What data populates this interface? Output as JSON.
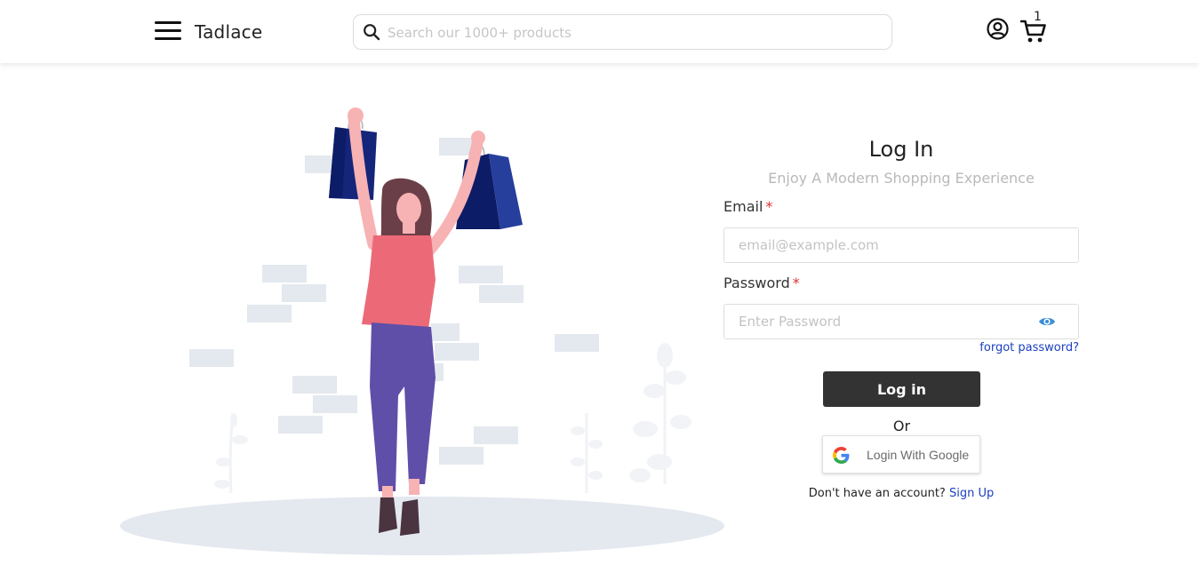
{
  "header": {
    "brand": "Tadlace",
    "search": {
      "placeholder": "Search our 1000+ products",
      "value": ""
    },
    "cart_count": "1"
  },
  "login": {
    "title": "Log In",
    "subtitle": "Enjoy A Modern Shopping Experience",
    "email": {
      "label": "Email",
      "required_mark": "*",
      "placeholder": "email@example.com",
      "value": ""
    },
    "password": {
      "label": "Password",
      "required_mark": "*",
      "placeholder": "Enter Password",
      "value": ""
    },
    "forgot_link": "forgot password?",
    "submit_label": "Log in",
    "or_text": "Or",
    "google_label": "Login With Google",
    "signup_prompt": "Don't have an account?",
    "signup_link": "Sign Up"
  },
  "icons": {
    "menu": "hamburger-menu-icon",
    "search": "search-icon",
    "user": "user-account-icon",
    "cart": "shopping-cart-icon",
    "password_toggle": "eye-icon",
    "google": "google-logo-icon"
  },
  "colors": {
    "primary_button": "#333333",
    "link": "#1b3fbf",
    "required": "#e03131",
    "eye_icon": "#3b8fd6"
  }
}
